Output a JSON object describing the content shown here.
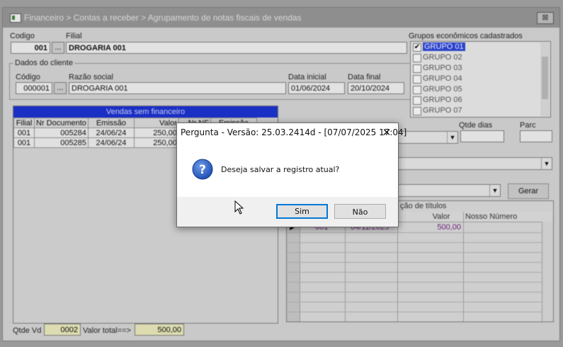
{
  "window": {
    "title": "Financeiro > Contas a receber > Agrupamento de notas fiscais de vendas",
    "close_glyph": "⊠"
  },
  "form": {
    "codigo_label": "Codigo",
    "codigo_value": "001",
    "filial_label": "Filial",
    "filial_value": "DROGARIA 001",
    "lookup_glyph": "...",
    "cliente_group_label": "Dados do cliente",
    "cliente_codigo_label": "Código",
    "cliente_codigo_value": "000001",
    "razao_social_label": "Razão social",
    "razao_social_value": "DROGARIA 001",
    "data_inicial_label": "Data inicial",
    "data_inicial_value": "01/06/2024",
    "data_final_label": "Data final",
    "data_final_value": "20/10/2024"
  },
  "grupos": {
    "label": "Grupos econômicos cadastrados",
    "items": [
      {
        "label": "GRUPO 01",
        "checked": "✔"
      },
      {
        "label": "GRUPO 02",
        "checked": ""
      },
      {
        "label": "GRUPO 03",
        "checked": ""
      },
      {
        "label": "GRUPO 04",
        "checked": ""
      },
      {
        "label": "GRUPO 05",
        "checked": ""
      },
      {
        "label": "GRUPO 06",
        "checked": ""
      },
      {
        "label": "GRUPO 07",
        "checked": ""
      }
    ]
  },
  "vendas": {
    "title": "Vendas sem financeiro",
    "columns": [
      "Filial",
      "Nr Documento",
      "Emissão",
      "Valor",
      "Nr NF",
      "Emissão"
    ],
    "rows": [
      {
        "filial": "001",
        "documento": "005284",
        "emissao": "24/06/24",
        "valor": "250,00"
      },
      {
        "filial": "001",
        "documento": "005285",
        "emissao": "24/06/24",
        "valor": "250,00"
      }
    ],
    "qtde_label": "Qtde Vd",
    "qtde_value": "0002",
    "total_label": "Valor total==>",
    "total_value": "500,00"
  },
  "right_panel": {
    "qtde_dias_label": "Qtde dias",
    "parc_label": "Parc",
    "gerar_label": "Gerar",
    "titulos_title": "ção de títulos",
    "columns": [
      "Valor",
      "Nosso Número"
    ],
    "row": {
      "vencimento": "04/11/2025",
      "valor": "500,00",
      "numero": "001"
    }
  },
  "dialog": {
    "title": "Pergunta - Versão: 25.03.2414d - [07/07/2025 17:04]",
    "close_glyph": "✕",
    "message": "Deseja salvar a registro atual?",
    "icon_glyph": "?",
    "yes_label": "Sim",
    "no_label": "Não"
  },
  "colors": {
    "accent_blue": "#1a2fc4",
    "dialog_default_border": "#0078d7"
  }
}
